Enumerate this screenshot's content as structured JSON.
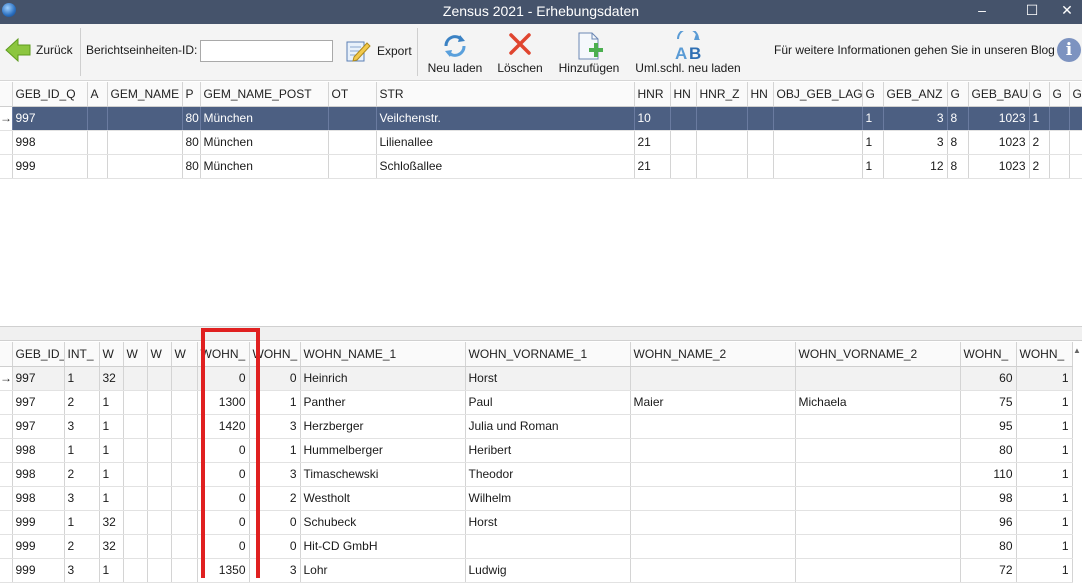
{
  "window": {
    "title": "Zensus 2021 - Erhebungsdaten",
    "minimize_glyph": "–",
    "maximize_glyph": "☐",
    "close_glyph": "✕"
  },
  "toolbar": {
    "back_label": "Zurück",
    "berichts_label": "Berichtseinheiten-ID:",
    "berichts_value": "",
    "export_label": "Export",
    "reload_label": "Neu laden",
    "delete_label": "Löschen",
    "add_label": "Hinzufügen",
    "uml_label": "Uml.schl. neu laden",
    "info_text": "Für weitere Informationen gehen Sie in unseren Blog",
    "info_glyph": "i"
  },
  "icons": {
    "back": "back-arrow-icon",
    "export": "export-icon",
    "reload": "reload-icon",
    "delete": "delete-icon",
    "add": "add-document-icon",
    "uml": "ab-reload-icon",
    "info": "info-icon",
    "row_indicator": "row-indicator-icon"
  },
  "colors": {
    "titlebar": "#45536b",
    "selected_row": "#4c5f82",
    "highlight": "#e02020",
    "delete_x": "#e0452f"
  },
  "upper_grid": {
    "columns": [
      "GEB_ID_Q",
      "A",
      "GEM_NAME",
      "P",
      "GEM_NAME_POST",
      "OT",
      "STR",
      "HNR",
      "HN",
      "HNR_Z",
      "HN",
      "OBJ_GEB_LAGE",
      "G",
      "GEB_ANZ",
      "G",
      "GEB_BAU",
      "G",
      "G",
      "G"
    ],
    "indicator": "→",
    "rows": [
      [
        "997",
        "",
        "",
        "80",
        "München",
        "",
        "Veilchenstr.",
        "10",
        "",
        "",
        "",
        "",
        "1",
        "3",
        "8",
        "1023",
        "1",
        "",
        ""
      ],
      [
        "998",
        "",
        "",
        "80",
        "München",
        "",
        "Lilienallee",
        "21",
        "",
        "",
        "",
        "",
        "1",
        "3",
        "8",
        "1023",
        "2",
        "",
        ""
      ],
      [
        "999",
        "",
        "",
        "80",
        "München",
        "",
        "Schloßallee",
        "21",
        "",
        "",
        "",
        "",
        "1",
        "12",
        "8",
        "1023",
        "2",
        "",
        ""
      ]
    ]
  },
  "lower_grid": {
    "columns": [
      "GEB_ID_",
      "INT_",
      "W",
      "W",
      "W",
      "W",
      "WOHN_",
      "WOHN_",
      "WOHN_NAME_1",
      "WOHN_VORNAME_1",
      "WOHN_NAME_2",
      "WOHN_VORNAME_2",
      "WOHN_",
      "WOHN_"
    ],
    "indicator": "→",
    "scroll_glyph": "▲",
    "rows": [
      [
        "997",
        "1",
        "32",
        "",
        "",
        "",
        "0",
        "0",
        "Heinrich",
        "Horst",
        "",
        "",
        "60",
        "1"
      ],
      [
        "997",
        "2",
        "1",
        "",
        "",
        "",
        "1300",
        "1",
        "Panther",
        "Paul",
        "Maier",
        "Michaela",
        "75",
        "1"
      ],
      [
        "997",
        "3",
        "1",
        "",
        "",
        "",
        "1420",
        "3",
        "Herzberger",
        "Julia und  Roman",
        "",
        "",
        "95",
        "1"
      ],
      [
        "998",
        "1",
        "1",
        "",
        "",
        "",
        "0",
        "1",
        "Hummelberger",
        "Heribert",
        "",
        "",
        "80",
        "1"
      ],
      [
        "998",
        "2",
        "1",
        "",
        "",
        "",
        "0",
        "3",
        "Timaschewski",
        "Theodor",
        "",
        "",
        "110",
        "1"
      ],
      [
        "998",
        "3",
        "1",
        "",
        "",
        "",
        "0",
        "2",
        "Westholt",
        "Wilhelm",
        "",
        "",
        "98",
        "1"
      ],
      [
        "999",
        "1",
        "32",
        "",
        "",
        "",
        "0",
        "0",
        "Schubeck",
        "Horst",
        "",
        "",
        "96",
        "1"
      ],
      [
        "999",
        "2",
        "32",
        "",
        "",
        "",
        "0",
        "0",
        "Hit-CD GmbH",
        "",
        "",
        "",
        "80",
        "1"
      ],
      [
        "999",
        "3",
        "1",
        "",
        "",
        "",
        "1350",
        "3",
        "Lohr",
        "Ludwig",
        "",
        "",
        "72",
        "1"
      ]
    ]
  }
}
